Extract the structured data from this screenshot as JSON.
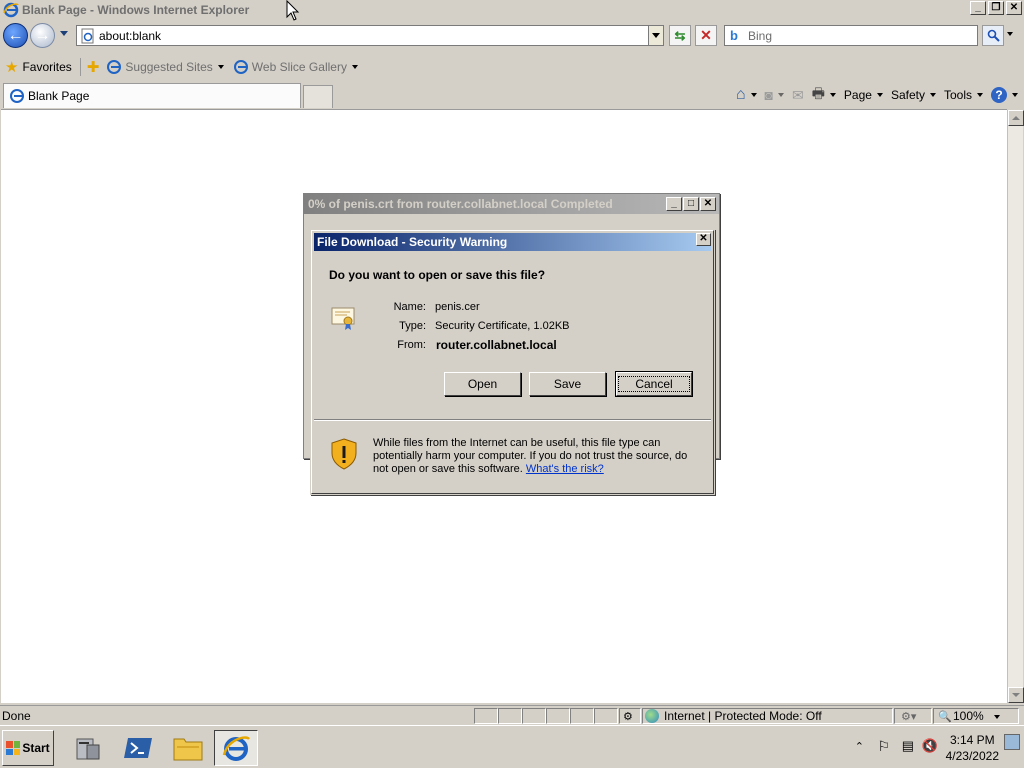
{
  "window": {
    "title": "Blank Page - Windows Internet Explorer",
    "controls": [
      "minimize",
      "restore",
      "close"
    ]
  },
  "navbar": {
    "address": "about:blank",
    "search_placeholder": "Bing"
  },
  "favorites_bar": {
    "favorites_label": "Favorites",
    "items": [
      {
        "label": "Suggested Sites"
      },
      {
        "label": "Web Slice Gallery"
      }
    ]
  },
  "tabs": [
    {
      "label": "Blank Page",
      "active": true
    }
  ],
  "command_bar": {
    "page_label": "Page",
    "safety_label": "Safety",
    "tools_label": "Tools"
  },
  "progress_window": {
    "title": "0% of penis.crt from router.collabnet.local Completed"
  },
  "dialog": {
    "title": "File Download - Security Warning",
    "question": "Do you want to open or save this file?",
    "name_label": "Name:",
    "name_value": "penis.cer",
    "type_label": "Type:",
    "type_value": "Security Certificate, 1.02KB",
    "from_label": "From:",
    "from_value": "router.collabnet.local",
    "buttons": {
      "open": "Open",
      "save": "Save",
      "cancel": "Cancel"
    },
    "warning_text": "While files from the Internet can be useful, this file type can potentially harm your computer. If you do not trust the source, do not open or save this software.",
    "warning_link": "What's the risk?"
  },
  "statusbar": {
    "status": "Done",
    "zone": "Internet | Protected Mode: Off",
    "zoom": "100%"
  },
  "taskbar": {
    "start_label": "Start",
    "time": "3:14 PM",
    "date": "4/23/2022"
  },
  "colors": {
    "dialog_title_start": "#0a246a",
    "dialog_title_end": "#a6caf0",
    "link": "#0033cc",
    "chrome": "#d4d0c8"
  }
}
